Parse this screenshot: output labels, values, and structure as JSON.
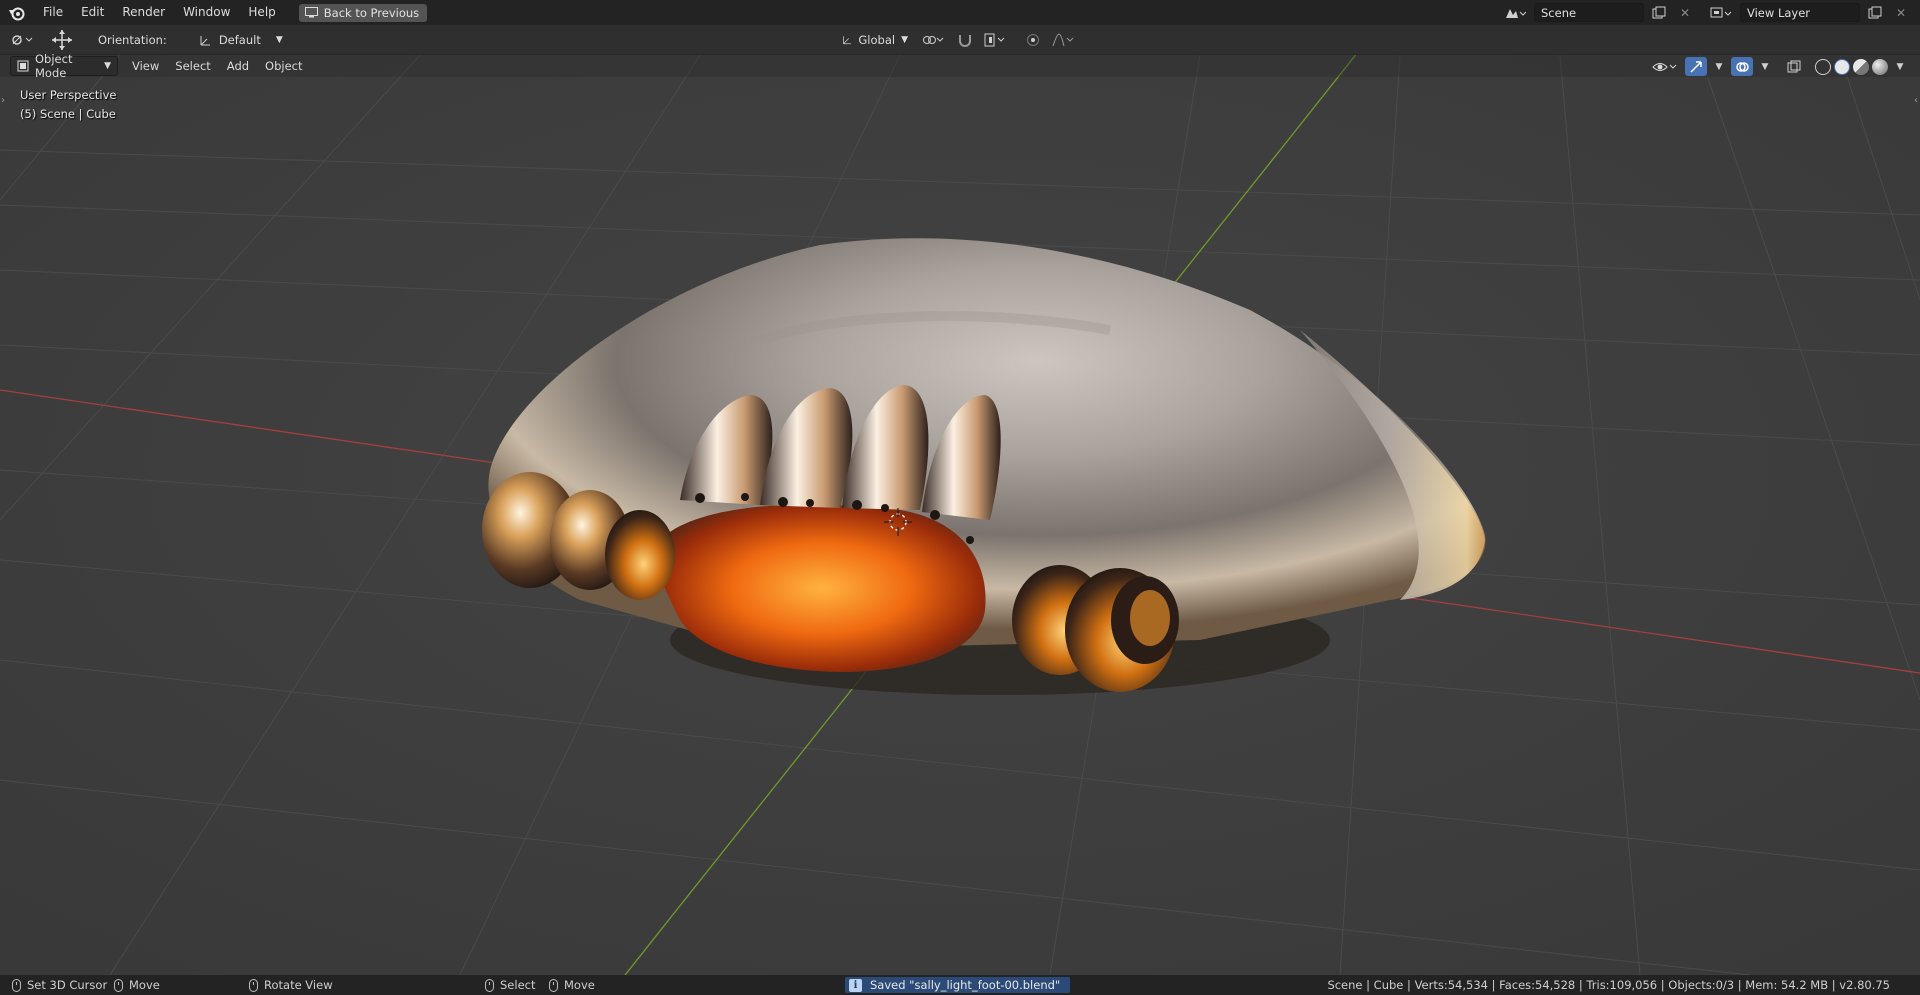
{
  "topbar": {
    "menus": [
      "File",
      "Edit",
      "Render",
      "Window",
      "Help"
    ],
    "back_label": "Back to Previous",
    "scene_name": "Scene",
    "view_layer": "View Layer"
  },
  "header": {
    "orientation_label": "Orientation:",
    "orientation_value": "Default",
    "transform_space": "Global"
  },
  "viewport_header": {
    "mode": "Object Mode",
    "menus": [
      "View",
      "Select",
      "Add",
      "Object"
    ]
  },
  "viewport": {
    "perspective": "User Perspective",
    "context": "(5) Scene | Cube"
  },
  "statusbar": {
    "set_cursor": "Set 3D Cursor",
    "move1": "Move",
    "rotate": "Rotate View",
    "select": "Select",
    "move2": "Move",
    "saved": "Saved \"sally_light_foot-00.blend\"",
    "stats": "Scene | Cube | Verts:54,534 | Faces:54,528 | Tris:109,056 | Objects:0/3 | Mem: 54.2 MB | v2.80.75"
  },
  "colors": {
    "x_axis": "#b24242",
    "y_axis": "#7aa12f",
    "grid": "#4a4a4a",
    "background": "#3d3d3d",
    "accent": "#4772b3"
  }
}
